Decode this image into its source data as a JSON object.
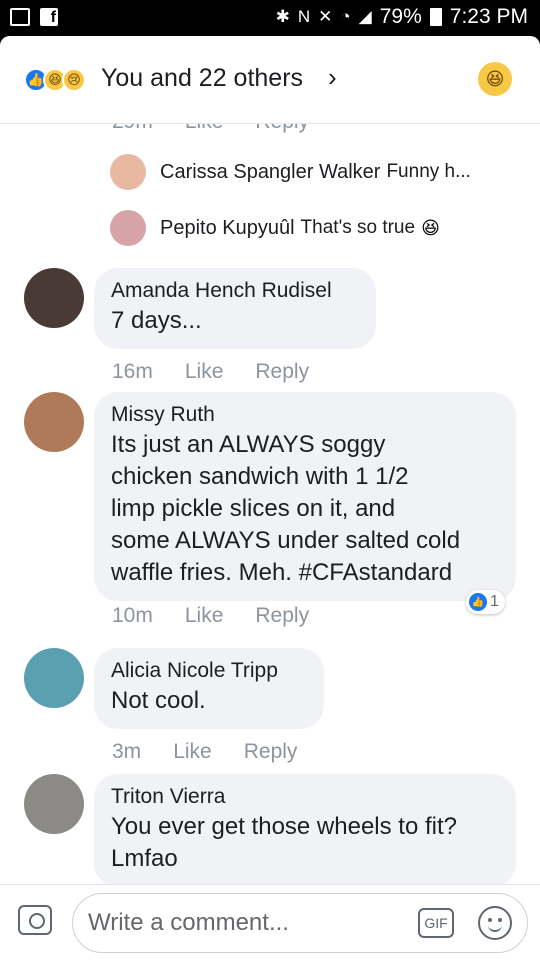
{
  "status_bar": {
    "battery": "79%",
    "time": "7:23 PM",
    "left_icons": [
      "gallery-icon",
      "facebook-icon"
    ],
    "right_icons": [
      "bluetooth-icon",
      "nfc-icon",
      "mute-icon",
      "wifi-icon",
      "signal-icon",
      "battery-icon"
    ]
  },
  "reactions": {
    "summary": "You and 22 others",
    "icons": [
      "like-reaction-icon",
      "haha-reaction-icon",
      "sad-reaction-icon"
    ]
  },
  "top_meta": {
    "time": "29m",
    "like": "Like",
    "reply": "Reply"
  },
  "replies": [
    {
      "name": "Carissa Spangler Walker",
      "text": "Funny h..."
    },
    {
      "name": "Pepito Kupyuûl",
      "text": "That's so true"
    }
  ],
  "comments": [
    {
      "name": "Amanda Hench Rudisel",
      "text": "7 days...",
      "time": "16m",
      "like": "Like",
      "reply": "Reply"
    },
    {
      "name": "Missy Ruth",
      "lines": [
        "Its just an ALWAYS soggy",
        "chicken sandwich with 1 1/2",
        "limp pickle slices on it, and",
        "some ALWAYS under salted cold",
        "waffle fries. Meh. #CFAstandard"
      ],
      "time": "10m",
      "like": "Like",
      "reply": "Reply",
      "like_count": "1"
    },
    {
      "name": "Alicia Nicole Tripp",
      "text": "Not cool.",
      "time": "3m",
      "like": "Like",
      "reply": "Reply"
    },
    {
      "name": "Triton Vierra",
      "lines": [
        "You ever get those wheels to fit?",
        "Lmfao"
      ]
    }
  ],
  "composer": {
    "placeholder": "Write a comment...",
    "gif_label": "GIF"
  },
  "colors": {
    "like_blue": "#1877f2",
    "bubble_bg": "#f0f2f5",
    "meta_gray": "#8d949e"
  }
}
